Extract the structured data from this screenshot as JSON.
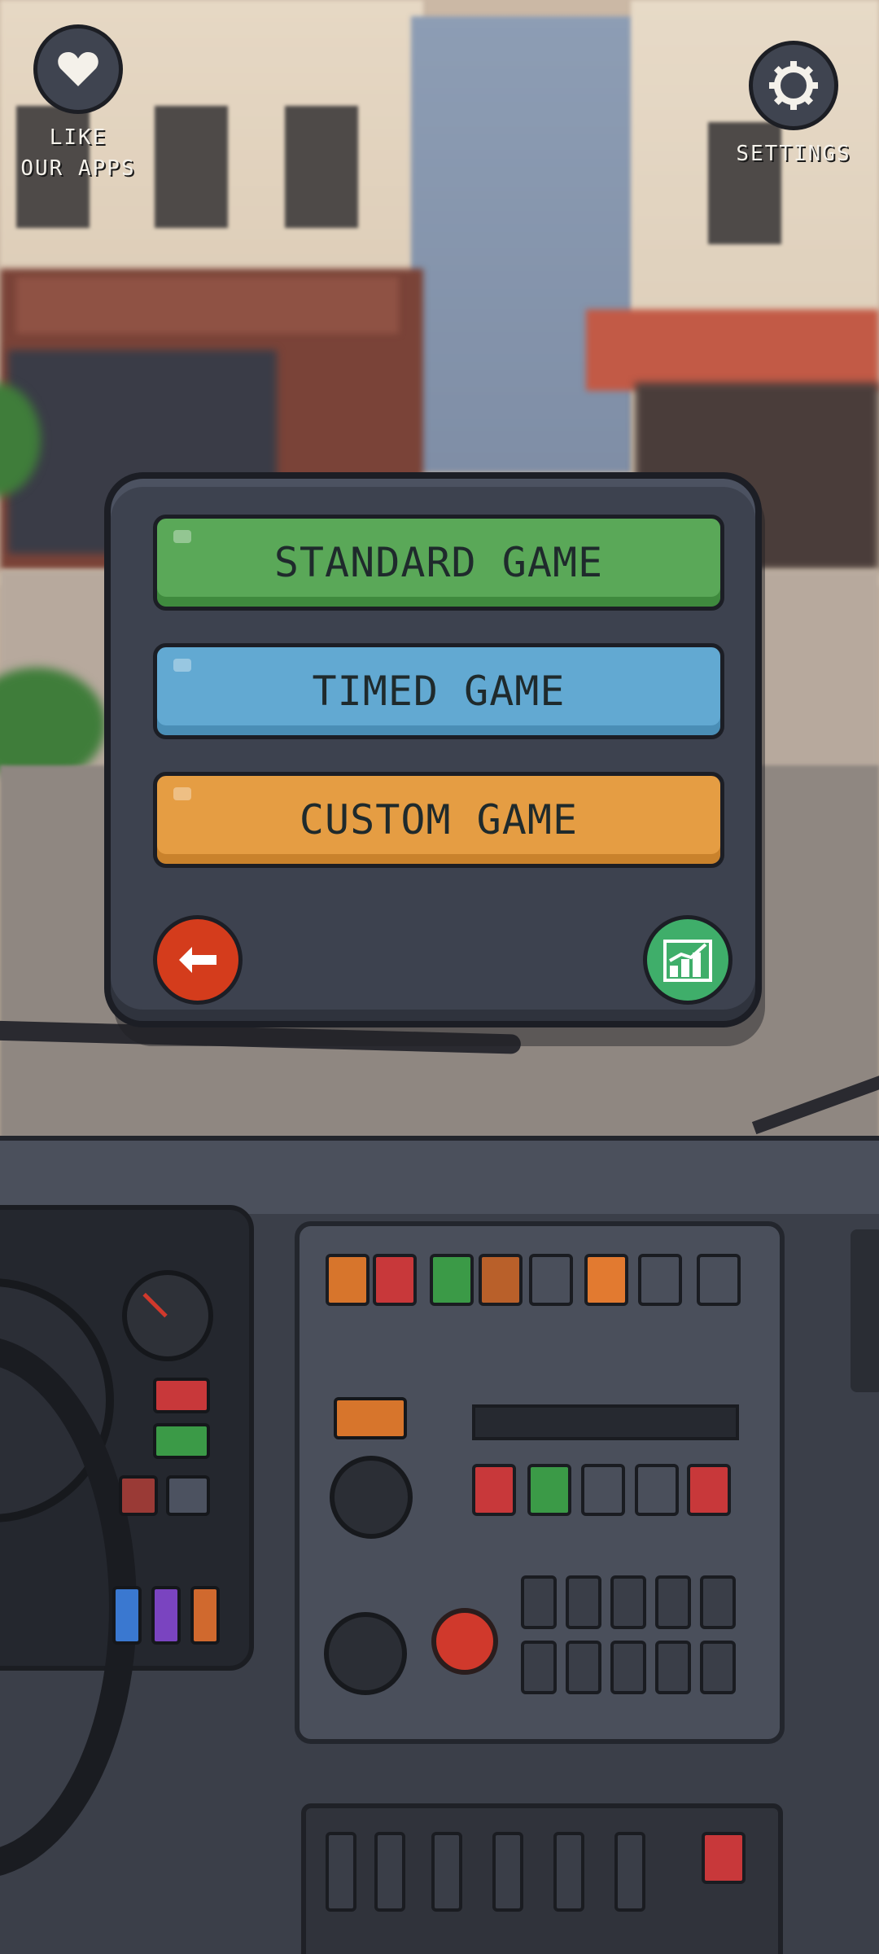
{
  "hud": {
    "like": {
      "label": "LIKE\nOUR APPS",
      "icon": "heart-icon"
    },
    "settings": {
      "label": "SETTINGS",
      "icon": "gear-icon"
    }
  },
  "menu": {
    "buttons": [
      {
        "label": "STANDARD GAME",
        "color": "#5aa858"
      },
      {
        "label": "TIMED GAME",
        "color": "#62a9d2"
      },
      {
        "label": "CUSTOM GAME",
        "color": "#e59d43"
      }
    ],
    "back": {
      "icon": "arrow-left-icon",
      "color": "#d43c1c"
    },
    "stats": {
      "icon": "chart-icon",
      "color": "#3fae6a"
    }
  }
}
